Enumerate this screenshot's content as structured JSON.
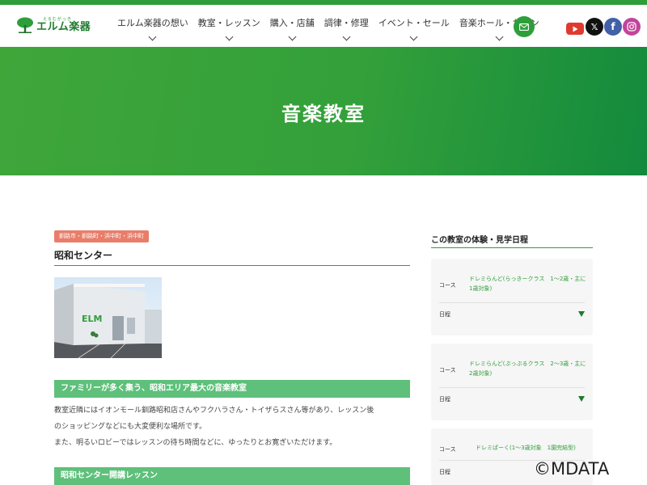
{
  "header": {
    "logo_sub": "えるむがっき",
    "logo_main": "エルム楽器",
    "nav": [
      {
        "label": "エルム楽器の想い"
      },
      {
        "label": "教室・レッスン"
      },
      {
        "label": "購入・店舗"
      },
      {
        "label": "調律・修理"
      },
      {
        "label": "イベント・セール"
      },
      {
        "label": "音楽ホール・サロン"
      }
    ],
    "social_icons": [
      "youtube-icon",
      "x-icon",
      "facebook-icon",
      "instagram-icon"
    ],
    "x_glyph": "𝕏",
    "fb_glyph": "f"
  },
  "hero": {
    "title": "音楽教室"
  },
  "main": {
    "tag": "釧路市・釧路町・浜中町・浜中町",
    "center_title": "昭和センター",
    "photo_sign": "ELM",
    "section1_heading": "ファミリーが多く集う、昭和エリア最大の音楽教室",
    "section1_lines": [
      "教室近隣にはイオンモール釧路昭和店さんやフクハラさん・トイザらスさん等があり、レッスン後",
      "のショッピングなどにも大変便利な場所です。",
      "また、明るいロビーではレッスンの待ち時間などに、ゆったりとお寛ぎいただけます。"
    ],
    "section2_heading": "昭和センター開講レッスン"
  },
  "sidebar": {
    "heading": "この教室の体験・見学日程",
    "cards": [
      {
        "course_label": "コース",
        "course_value": "ドレミらんど(らっきークラス　1～2歳・主に1歳対象)",
        "schedule_label": "日程"
      },
      {
        "course_label": "コース",
        "course_value": "ドレミらんど(ぷっぷるクラス　2～3歳・主に2歳対象)",
        "schedule_label": "日程"
      },
      {
        "course_label": "コース",
        "course_value": "ドレミぱーく(1～3歳対象　1園完結型)",
        "schedule_label": "日程"
      }
    ]
  },
  "watermark": "©MDATA",
  "colors": {
    "brand_green": "#2e9e3a",
    "tag_salmon": "#e87e6a",
    "section_green": "#5ec07a"
  }
}
